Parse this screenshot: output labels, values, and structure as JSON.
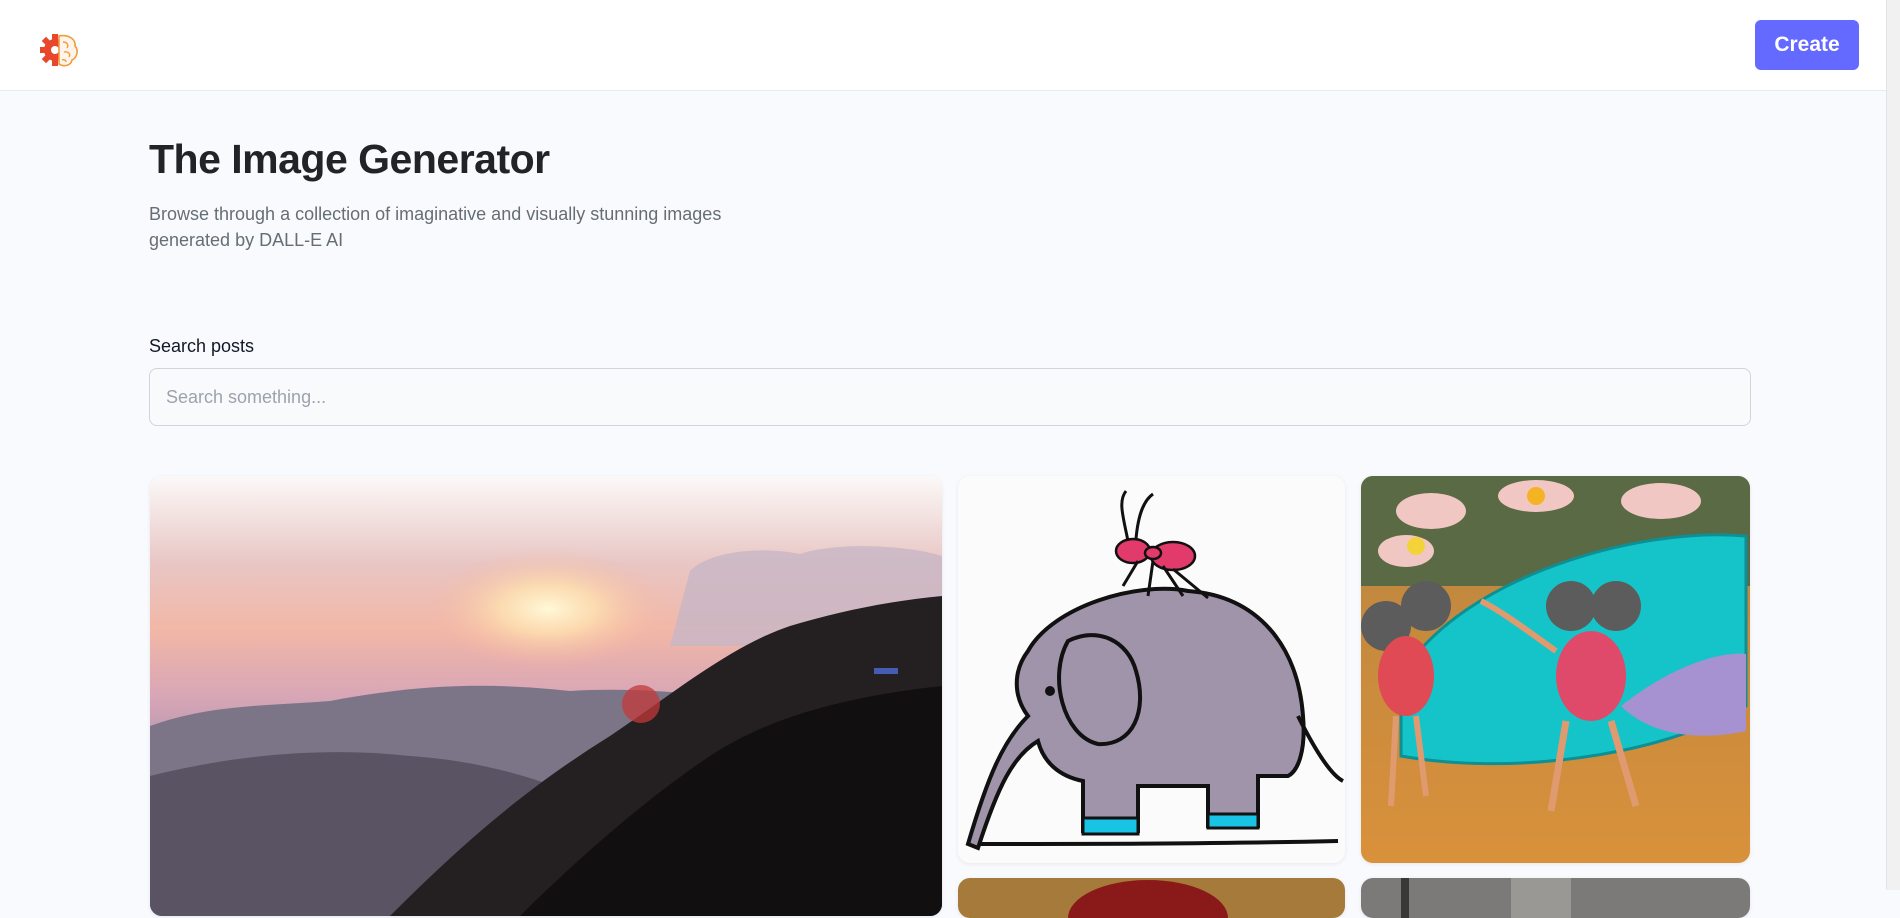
{
  "header": {
    "logo_icon": "brain-gear-icon",
    "create_label": "Create"
  },
  "hero": {
    "title": "The Image Generator",
    "subtitle": "Browse through a collection of imaginative and visually stunning images generated by DALL-E AI"
  },
  "search": {
    "label": "Search posts",
    "placeholder": "Search something...",
    "value": ""
  },
  "posts": [
    {
      "image": "sunset-over-forested-hills"
    },
    {
      "image": "ant-riding-elephant-cartoon"
    },
    {
      "image": "clay-mice-with-surfboard"
    },
    {
      "image": "partial-image-red"
    },
    {
      "image": "partial-image-gray"
    }
  ],
  "colors": {
    "accent": "#6469ff",
    "background": "#f9fafe",
    "title": "#222328",
    "subtitle": "#666e75"
  }
}
